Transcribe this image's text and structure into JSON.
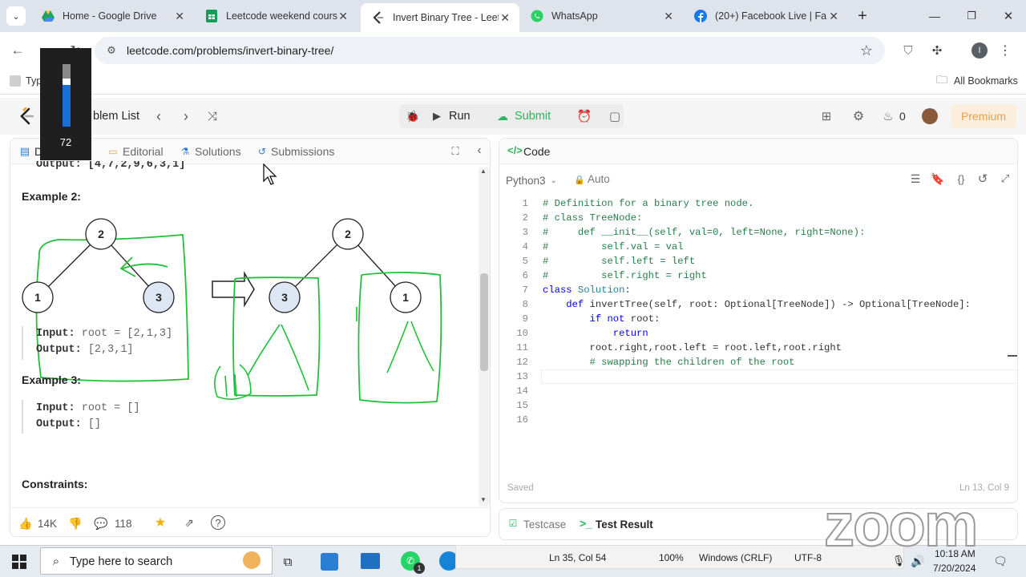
{
  "browser": {
    "tabs": [
      {
        "title": "Home - Google Drive",
        "icon": "google-drive-icon"
      },
      {
        "title": "Leetcode weekend cours",
        "icon": "google-sheets-icon"
      },
      {
        "title": "Invert Binary Tree - LeetC",
        "icon": "leetcode-icon"
      },
      {
        "title": "WhatsApp",
        "icon": "whatsapp-icon"
      },
      {
        "title": "(20+) Facebook Live | Fa",
        "icon": "facebook-icon"
      }
    ],
    "url": "leetcode.com/problems/invert-binary-tree/",
    "bookmarks_left": "Typ",
    "bookmarks_all": "All Bookmarks",
    "profile_initial": "I"
  },
  "volume_overlay": {
    "value": "72",
    "level": 0.72
  },
  "leetcode": {
    "problem_list": "blem List",
    "run": "Run",
    "submit": "Submit",
    "streak": "0",
    "premium": "Premium",
    "left_tabs": {
      "desc": "D",
      "editorial": "Editorial",
      "solutions": "Solutions",
      "submissions": "Submissions"
    },
    "desc": {
      "prev_output": "Output: [4,7,2,9,6,3,1]",
      "ex2_title": "Example 2:",
      "ex2_input_label": "Input:",
      "ex2_input_val": "root = [2,1,3]",
      "ex2_output_label": "Output:",
      "ex2_output_val": "[2,3,1]",
      "ex3_title": "Example 3:",
      "ex3_input_label": "Input:",
      "ex3_input_val": "root = []",
      "ex3_output_label": "Output:",
      "ex3_output_val": "[]",
      "constraints": "Constraints:",
      "tree_left": {
        "root": "2",
        "left": "1",
        "right": "3"
      },
      "tree_right": {
        "root": "2",
        "left": "3",
        "right": "1"
      }
    },
    "footer": {
      "likes": "14K",
      "comments": "118"
    },
    "code_tab": "Code",
    "language": "Python3",
    "auto": "Auto",
    "saved": "Saved",
    "cursor_pos": "Ln 13, Col 9",
    "code_lines": [
      "# Definition for a binary tree node.",
      "# class TreeNode:",
      "#     def __init__(self, val=0, left=None, right=None):",
      "#         self.val = val",
      "#         self.left = left",
      "#         self.right = right",
      "class Solution:",
      "    def invertTree(self, root: Optional[TreeNode]) -> Optional[TreeNode]:",
      "        if not root:",
      "            return",
      "        root.right,root.left = root.left,root.right",
      "        # swapping the children of the root",
      "",
      "",
      "",
      ""
    ],
    "line_numbers": [
      "1",
      "2",
      "3",
      "4",
      "5",
      "6",
      "7",
      "8",
      "9",
      "10",
      "11",
      "12",
      "13",
      "14",
      "15",
      "16"
    ],
    "testcase": "Testcase",
    "test_result": "Test Result"
  },
  "vscode_status": {
    "pos": "Ln 35, Col 54",
    "zoom": "100%",
    "eol": "Windows (CRLF)",
    "enc": "UTF-8"
  },
  "zoom_watermark": "zoom",
  "taskbar": {
    "search_placeholder": "Type here to search",
    "time": "10:18 AM",
    "date": "7/20/2024",
    "whatsapp_badge": "1"
  },
  "colors": {
    "accent_green": "#2db55d",
    "annotation_green": "#22c03a",
    "premium_orange": "#e8a04b"
  }
}
